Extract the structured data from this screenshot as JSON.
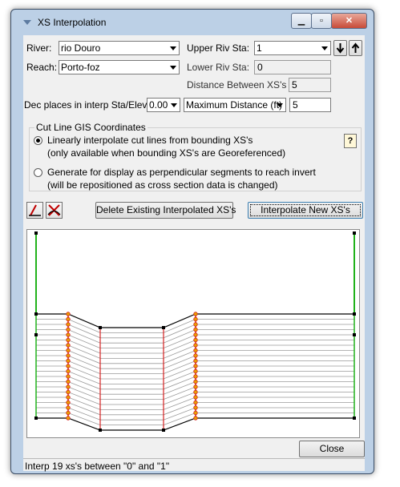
{
  "window": {
    "title": "XS Interpolation",
    "close_glyph": "✕"
  },
  "river": {
    "label": "River:",
    "value": "rio Douro"
  },
  "reach": {
    "label": "Reach:",
    "value": "Porto-foz"
  },
  "upper_riv_sta": {
    "label": "Upper Riv Sta:",
    "value": "1"
  },
  "lower_riv_sta": {
    "label": "Lower Riv Sta:",
    "value": "0"
  },
  "distance_between": {
    "label": "Distance Between XS's",
    "value": "5"
  },
  "dec_places": {
    "label": "Dec places in interp Sta/Elev:",
    "value": "0.00"
  },
  "max_distance": {
    "select_value": "Maximum Distance (ft)",
    "value": "5"
  },
  "cut_line": {
    "group_title": "Cut Line GIS Coordinates",
    "option1_line1": "Linearly interpolate cut lines from bounding XS's",
    "option1_line2": "(only available when bounding XS's are Georeferenced)",
    "option2_line1": "Generate for display as perpendicular segments to reach invert",
    "option2_line2": "(will be repositioned as cross section data is changed)",
    "selected": 1,
    "help_label": "?"
  },
  "buttons": {
    "delete": "Delete Existing Interpolated XS's",
    "interpolate": "Interpolate New XS's",
    "close": "Close"
  },
  "icons": [
    "arrow-down-icon",
    "arrow-up-icon",
    "help-icon",
    "draw-line-icon",
    "cut-line-icon"
  ],
  "plot": {
    "interpolated_count": 19,
    "line_color": "#9a9a9a",
    "bank_color": "#d42020",
    "levee_color": "#21b21b",
    "point_color": "#e8a000"
  },
  "status": {
    "text": "Interp 19 xs's between \"0\" and \"1\""
  }
}
